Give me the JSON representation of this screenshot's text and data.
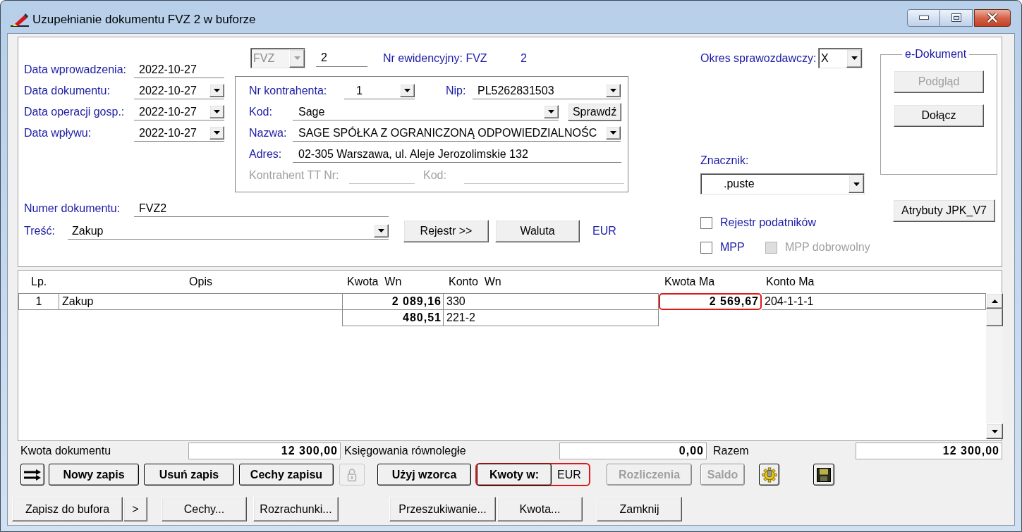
{
  "window": {
    "title": "Uzupełnianie dokumentu FVZ 2 w buforze"
  },
  "document": {
    "dates": [
      {
        "label": "Data wprowadzenia:",
        "value": "2022-10-27",
        "kind": "text"
      },
      {
        "label": "Data dokumentu:",
        "value": "2022-10-27",
        "kind": "dropdown"
      },
      {
        "label": "Data operacji gosp.:",
        "value": "2022-10-27",
        "kind": "dropdown"
      },
      {
        "label": "Data wpływu:",
        "value": "2022-10-27",
        "kind": "dropdown"
      }
    ],
    "series": {
      "value": "FVZ",
      "disabled": true
    },
    "number": "2",
    "register_number": {
      "label": "Nr ewidencyjny: FVZ",
      "value": "2"
    },
    "document_number": {
      "label": "Numer dokumentu:",
      "value": "FVZ2"
    },
    "description": {
      "label": "Treść:",
      "value": "Zakup"
    },
    "buttons": [
      {
        "label": "Rejestr >>"
      },
      {
        "label": "Waluta"
      }
    ],
    "currency": "EUR"
  },
  "contractor": {
    "number": {
      "label": "Nr kontrahenta:",
      "value": "1"
    },
    "nip": {
      "label": "Nip:",
      "value": "PL5262831503"
    },
    "code": {
      "label": "Kod:",
      "value": "Sage"
    },
    "check_button": {
      "label": "Sprawdź"
    },
    "name": {
      "label": "Nazwa:",
      "value": "SAGE SPÓŁKA Z OGRANICZONĄ ODPOWIEDZIALNOŚC"
    },
    "address": {
      "label": "Adres:",
      "value": "02-305 Warszawa, ul. Aleje Jerozolimskie 132"
    },
    "tt_number": {
      "label": "Kontrahent TT Nr:",
      "disabled": true
    },
    "tt_code": {
      "label": "Kod:",
      "disabled": true
    }
  },
  "reporting_period": {
    "label": "Okres sprawozdawczy:",
    "value": "X"
  },
  "e_document": {
    "title": "e-Dokument",
    "buttons": [
      {
        "label": "Podgląd",
        "disabled": true
      },
      {
        "label": "Dołącz",
        "disabled": false
      }
    ]
  },
  "marker": {
    "label": "Znacznik:",
    "value": ".puste"
  },
  "checkboxes": [
    {
      "label": "Rejestr podatników",
      "checked": false,
      "disabled": false
    },
    {
      "label": "MPP",
      "checked": false,
      "disabled": false
    },
    {
      "label": "MPP dobrowolny",
      "checked": false,
      "disabled": true
    }
  ],
  "jpk_button": {
    "label": "Atrybuty JPK_V7"
  },
  "table": {
    "columns": [
      "Lp.",
      "Opis",
      "Kwota  Wn",
      "Konto  Wn",
      "Kwota Ma",
      "Konto Ma"
    ],
    "entries": [
      {
        "lp": "1",
        "opis": "Zakup",
        "wn": [
          {
            "amount": "2 089,16",
            "account": "330",
            "highlighted": false
          },
          {
            "amount": "480,51",
            "account": "221-2",
            "highlighted": false
          }
        ],
        "ma": [
          {
            "amount": "2 569,67",
            "account": "204-1-1-1",
            "highlighted": true
          }
        ]
      }
    ]
  },
  "totals": [
    {
      "label": "Kwota dokumentu",
      "value": "12 300,00"
    },
    {
      "label": "Księgowania równoległe",
      "value": "0,00"
    },
    {
      "label": "Razem",
      "value": "12 300,00"
    }
  ],
  "record_toolbar": [
    {
      "kind": "switch",
      "disabled": false
    },
    {
      "kind": "text",
      "label": "Nowy zapis",
      "disabled": false
    },
    {
      "kind": "text",
      "label": "Usuń zapis",
      "disabled": false
    },
    {
      "kind": "text",
      "label": "Cechy zapisu",
      "disabled": false
    },
    {
      "kind": "lock",
      "disabled": true
    },
    {
      "kind": "text",
      "label": "Użyj wzorca",
      "disabled": false
    },
    {
      "kind": "currency",
      "label": "Kwoty w:",
      "value": "EUR",
      "highlighted": true,
      "disabled": false
    },
    {
      "kind": "text",
      "label": "Rozliczenia",
      "disabled": true
    },
    {
      "kind": "text",
      "label": "Saldo",
      "disabled": true
    },
    {
      "kind": "gear",
      "disabled": false
    },
    {
      "kind": "save",
      "disabled": false
    }
  ],
  "dialog_buttons": [
    {
      "label": "Zapisz do bufora"
    },
    {
      "label": ">"
    },
    {
      "label": "Cechy..."
    },
    {
      "label": "Rozrachunki..."
    },
    {
      "label": "Przeszukiwanie..."
    },
    {
      "label": "Kwota..."
    },
    {
      "label": "Zamknij"
    }
  ]
}
